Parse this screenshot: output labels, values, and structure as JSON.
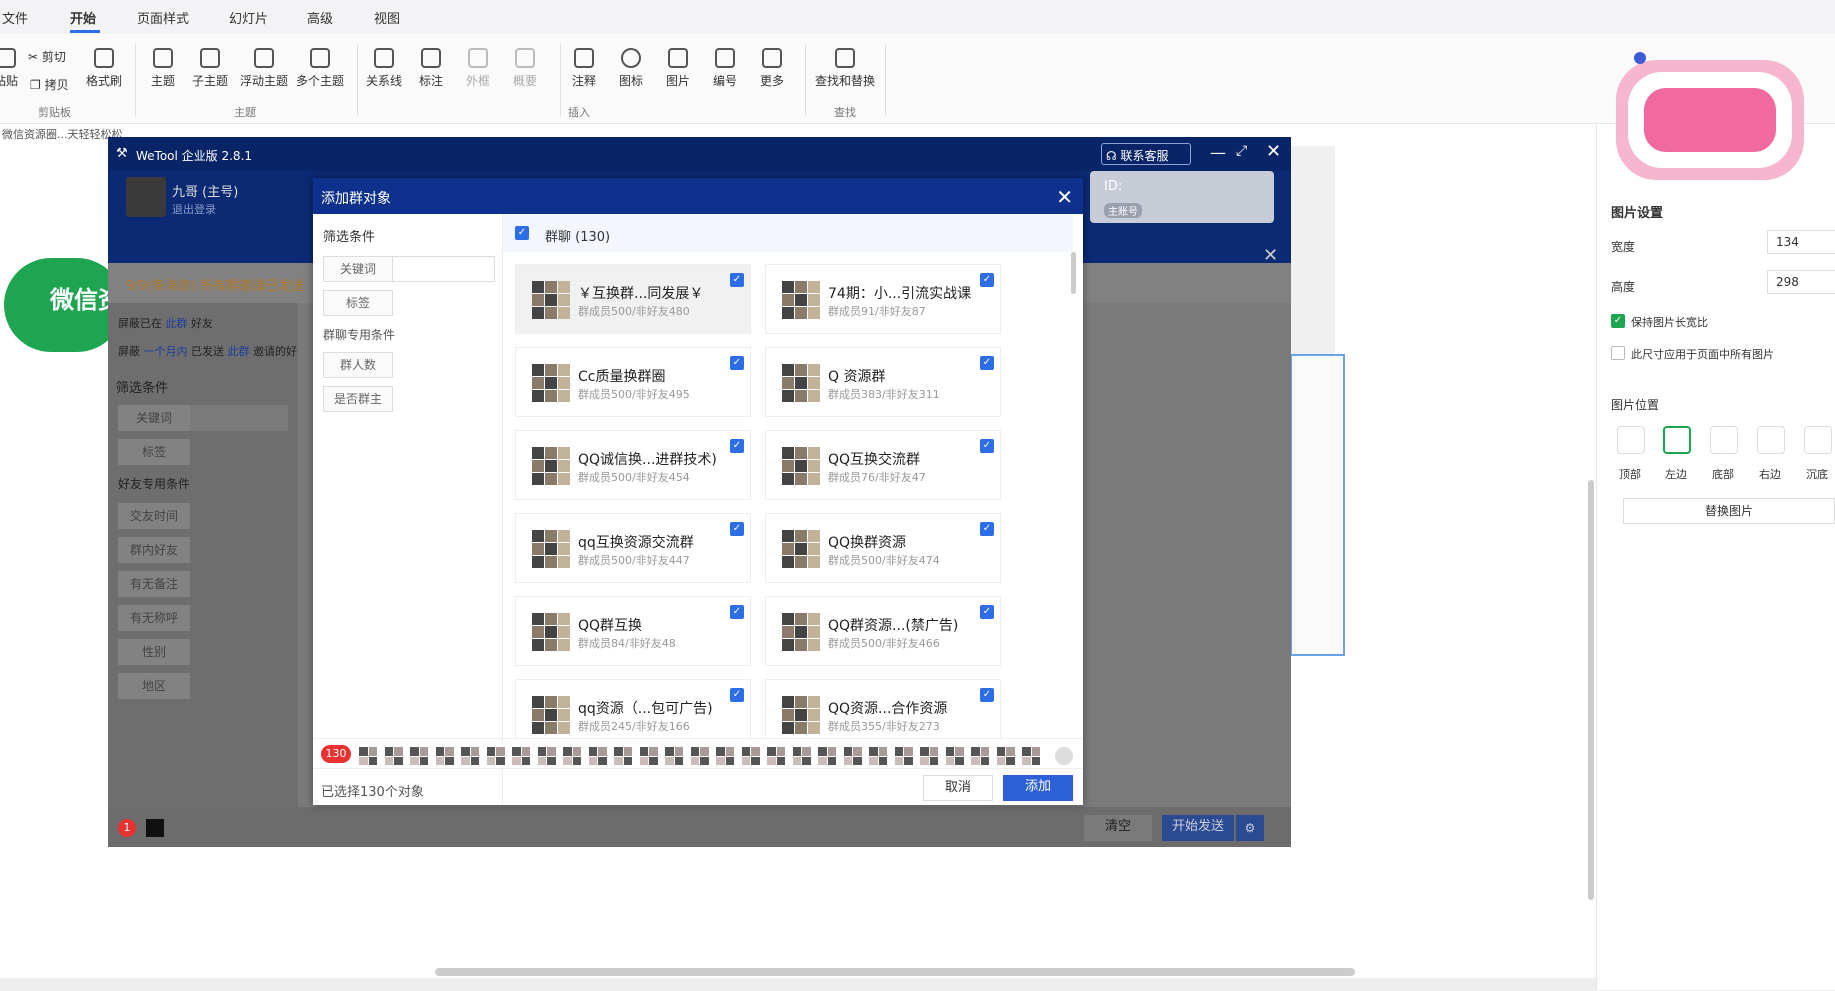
{
  "menubar": {
    "tabs": [
      "文件",
      "开始",
      "页面样式",
      "幻灯片",
      "高级",
      "视图"
    ]
  },
  "ribbon": {
    "buttons": [
      "粘贴",
      "剪切",
      "拷贝",
      "格式刷",
      "主题",
      "子主题",
      "浮动主题",
      "多个主题",
      "关系线",
      "标注",
      "外框",
      "概要",
      "注释",
      "图标",
      "图片",
      "编号",
      "更多",
      "查找和替换"
    ],
    "groups": [
      "剪贴板",
      "主题",
      "插入",
      "查找"
    ]
  },
  "doc": {
    "tab_label": "微信资源圈...天轻轻松松",
    "green_text": "微信资"
  },
  "right_panel": {
    "title": "图片设置",
    "width_label": "宽度",
    "width_value": "134",
    "height_label": "高度",
    "height_value": "298",
    "keep_ratio": "保持图片长宽比",
    "apply_all": "此尺寸应用于页面中所有图片",
    "position_title": "图片位置",
    "positions": [
      "顶部",
      "左边",
      "底部",
      "右边",
      "沉底"
    ],
    "replace_button": "替换图片"
  },
  "wetool": {
    "title": "WeTool 企业版 2.8.1",
    "contact_service": "联系客服",
    "user_name": "九哥 (主号)",
    "logout": "退出登录",
    "id_label": "ID:",
    "main_badge": "主账号",
    "notice": "9/9(条消息) 所有群邀请已发送",
    "block1_a": "屏蔽已在",
    "block1_link": "此群",
    "block1_b": "好友",
    "block2_a": "屏蔽",
    "block2_link1": "一个月内",
    "block2_b": "已发送",
    "block2_link2": "此群",
    "block2_c": "邀请的好",
    "filter_title": "筛选条件",
    "keyword": "关键词",
    "tag": "标签",
    "friend_conditions": "好友专用条件",
    "friend_filters": [
      "交友时间",
      "群内好友",
      "有无备注",
      "有无称呼",
      "性别",
      "地区"
    ],
    "clear_button": "清空",
    "send_button": "开始发送",
    "notif_count": "1"
  },
  "modal": {
    "title": "添加群对象",
    "filter_title": "筛选条件",
    "keyword": "关键词",
    "tag": "标签",
    "group_conditions": "群聊专用条件",
    "group_filters": [
      "群人数",
      "是否群主"
    ],
    "select_all_label": "群聊 (130)",
    "groups": [
      {
        "name": "￥互换群...同发展￥",
        "sub": "群成员500/非好友480"
      },
      {
        "name": "74期：小...引流实战课",
        "sub": "群成员91/非好友87"
      },
      {
        "name": "Cc质量换群圈",
        "sub": "群成员500/非好友495"
      },
      {
        "name": "Q 资源群",
        "sub": "群成员383/非好友311"
      },
      {
        "name": "QQ诚信换...进群技术)",
        "sub": "群成员500/非好友454"
      },
      {
        "name": "QQ互换交流群",
        "sub": "群成员76/非好友47"
      },
      {
        "name": "qq互换资源交流群",
        "sub": "群成员500/非好友447"
      },
      {
        "name": "QQ换群资源",
        "sub": "群成员500/非好友474"
      },
      {
        "name": "QQ群互换",
        "sub": "群成员84/非好友48"
      },
      {
        "name": "QQ群资源...(禁广告)",
        "sub": "群成员500/非好友466"
      },
      {
        "name": "qq资源（...包可广告)",
        "sub": "群成员245/非好友166"
      },
      {
        "name": "QQ资源...合作资源",
        "sub": "群成员355/非好友273"
      }
    ],
    "selected_badge": "130",
    "selected_text": "已选择130个对象",
    "cancel": "取消",
    "add": "添加"
  },
  "colors": {
    "modal_header": "#0e318d",
    "accent": "#2d6ee6",
    "green": "#1fa552",
    "badge_red": "#e8322f"
  }
}
